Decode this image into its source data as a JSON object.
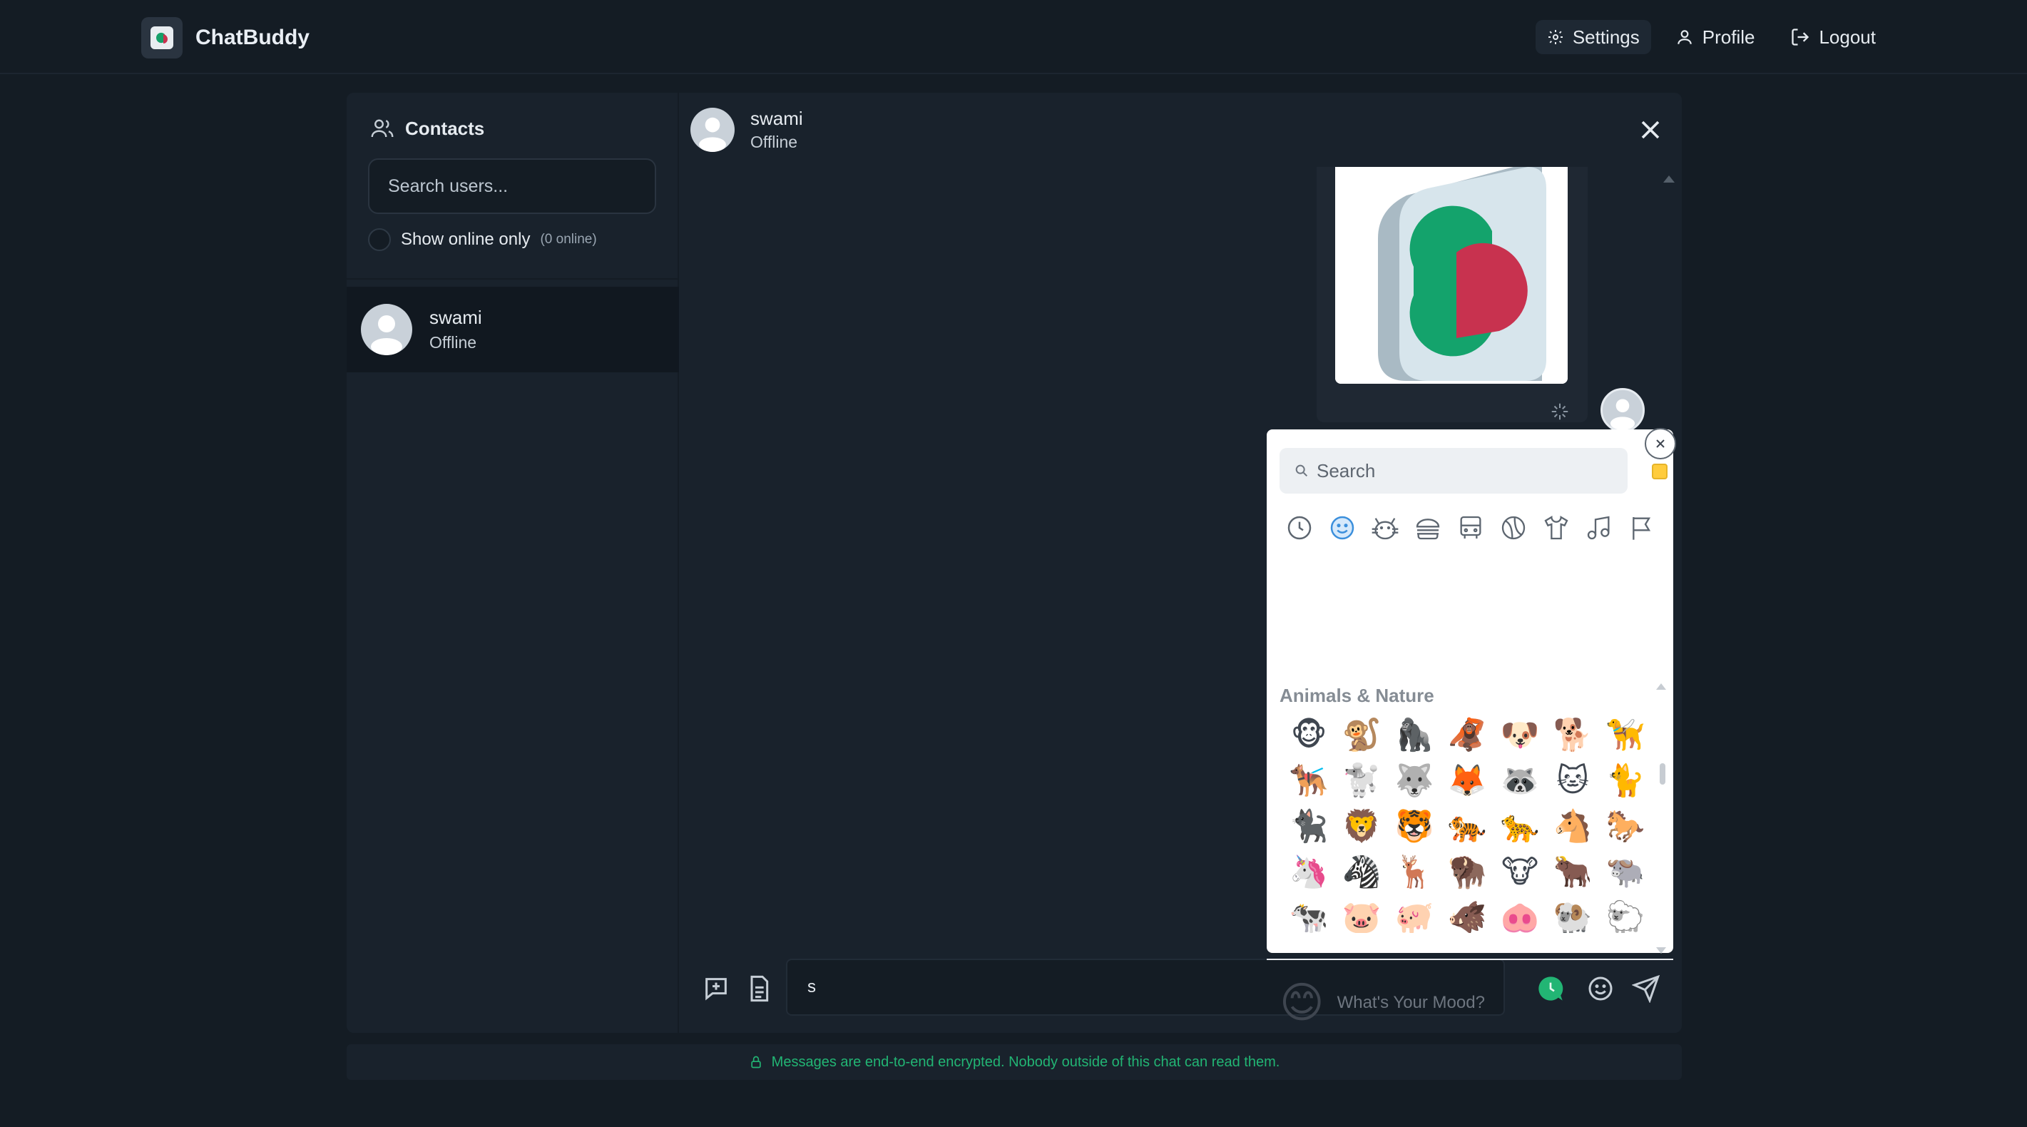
{
  "app": {
    "title": "ChatBuddy"
  },
  "nav": {
    "settings": "Settings",
    "profile": "Profile",
    "logout": "Logout"
  },
  "contacts": {
    "title": "Contacts",
    "search_placeholder": "Search users...",
    "online_only_label": "Show online only",
    "online_count": "(0 online)",
    "items": [
      {
        "name": "swami",
        "status": "Offline"
      }
    ]
  },
  "chat": {
    "contact_name": "swami",
    "contact_status": "Offline",
    "input_value": "s"
  },
  "emoji_picker": {
    "search_placeholder": "Search",
    "categories": [
      "recent-icon",
      "smileys-icon",
      "animals-icon",
      "food-icon",
      "travel-icon",
      "activity-icon",
      "objects-icon",
      "symbols-icon",
      "flags-icon"
    ],
    "active_category": "smileys-icon",
    "section_label": "Animals & Nature",
    "emojis": [
      "🐵",
      "🐒",
      "🦍",
      "🦧",
      "🐶",
      "🐕",
      "🦮",
      "🐕‍🦺",
      "🐩",
      "🐺",
      "🦊",
      "🦝",
      "🐱",
      "🐈",
      "🐈‍⬛",
      "🦁",
      "🐯",
      "🐅",
      "🐆",
      "🐴",
      "🐎",
      "🦄",
      "🦓",
      "🦌",
      "🦬",
      "🐮",
      "🐂",
      "🐃",
      "🐄",
      "🐷",
      "🐖",
      "🐗",
      "🐽",
      "🐏",
      "🐑"
    ],
    "skin_tone_color": "#ffcc3d",
    "mood_emoji": "😊",
    "mood_placeholder": "What's Your Mood?"
  },
  "footer": {
    "encryption_notice": "Messages are end-to-end encrypted. Nobody outside of this chat can read them."
  },
  "colors": {
    "background": "#141c24",
    "panel": "#19222c",
    "accent_green": "#22b574"
  }
}
